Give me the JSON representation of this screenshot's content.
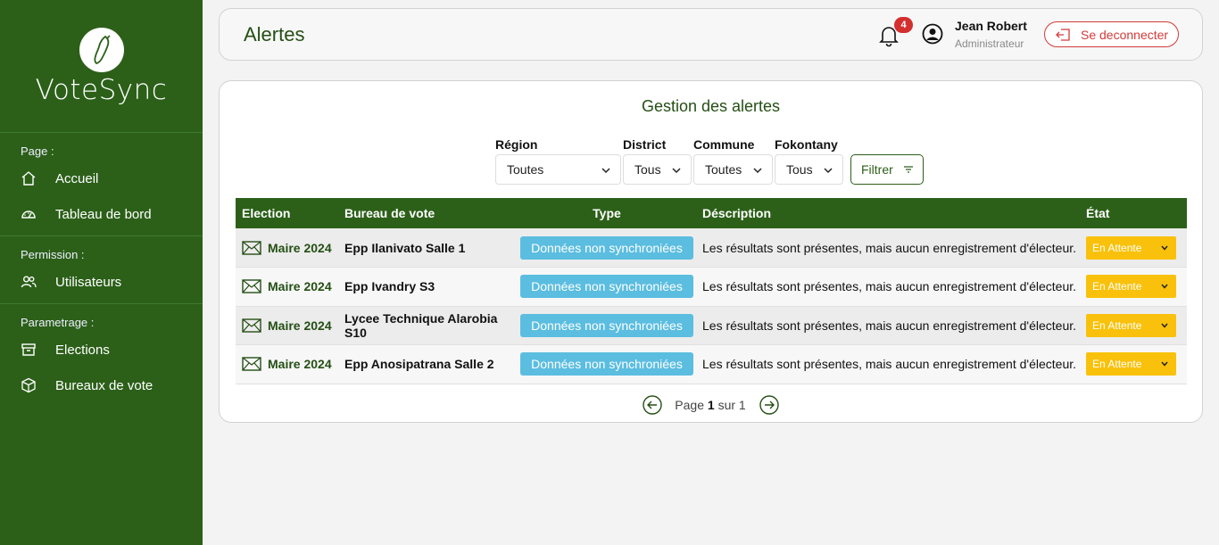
{
  "app": {
    "brand": "VoteSync"
  },
  "sidebar": {
    "sections": [
      {
        "title": "Page :",
        "items": [
          {
            "label": "Accueil",
            "icon": "home-icon"
          },
          {
            "label": "Tableau de bord",
            "icon": "dashboard-icon"
          }
        ]
      },
      {
        "title": "Permission :",
        "items": [
          {
            "label": "Utilisateurs",
            "icon": "users-icon"
          }
        ]
      },
      {
        "title": "Parametrage :",
        "items": [
          {
            "label": "Elections",
            "icon": "archive-icon"
          },
          {
            "label": "Bureaux de vote",
            "icon": "box-icon"
          }
        ]
      }
    ]
  },
  "header": {
    "title": "Alertes",
    "notification_count": "4",
    "user_name": "Jean Robert",
    "user_role": "Administrateur",
    "logout_label": "Se deconnecter"
  },
  "card": {
    "title": "Gestion des alertes",
    "filters": {
      "region": {
        "label": "Région",
        "value": "Toutes"
      },
      "district": {
        "label": "District",
        "value": "Tous"
      },
      "commune": {
        "label": "Commune",
        "value": "Toutes"
      },
      "fokontany": {
        "label": "Fokontany",
        "value": "Tous"
      },
      "button": "Filtrer"
    },
    "table": {
      "headers": [
        "Election",
        "Bureau de vote",
        "Type",
        "Déscription",
        "État"
      ],
      "rows": [
        {
          "election": "Maire 2024",
          "bureau": "Epp Ilanivato Salle 1",
          "type": "Données non synchroniées",
          "description": "Les résultats sont présentes, mais aucun enregistrement d'électeur.",
          "etat": "En Attente"
        },
        {
          "election": "Maire 2024",
          "bureau": "Epp Ivandry S3",
          "type": "Données non synchroniées",
          "description": "Les résultats sont présentes, mais aucun enregistrement d'électeur.",
          "etat": "En Attente"
        },
        {
          "election": "Maire 2024",
          "bureau": "Lycee Technique Alarobia S10",
          "type": "Données non synchroniées",
          "description": "Les résultats sont présentes, mais aucun enregistrement d'électeur.",
          "etat": "En Attente"
        },
        {
          "election": "Maire 2024",
          "bureau": "Epp Anosipatrana Salle 2",
          "type": "Données non synchroniées",
          "description": "Les résultats sont présentes, mais aucun enregistrement d'électeur.",
          "etat": "En Attente"
        }
      ]
    },
    "pagination": {
      "prefix": "Page",
      "current": "1",
      "separator": "sur",
      "total": "1"
    }
  },
  "colors": {
    "primary_green": "#2c6019",
    "badge_blue": "#5bbde0",
    "state_yellow": "#f9c10b",
    "danger_red": "#d43b3b"
  }
}
